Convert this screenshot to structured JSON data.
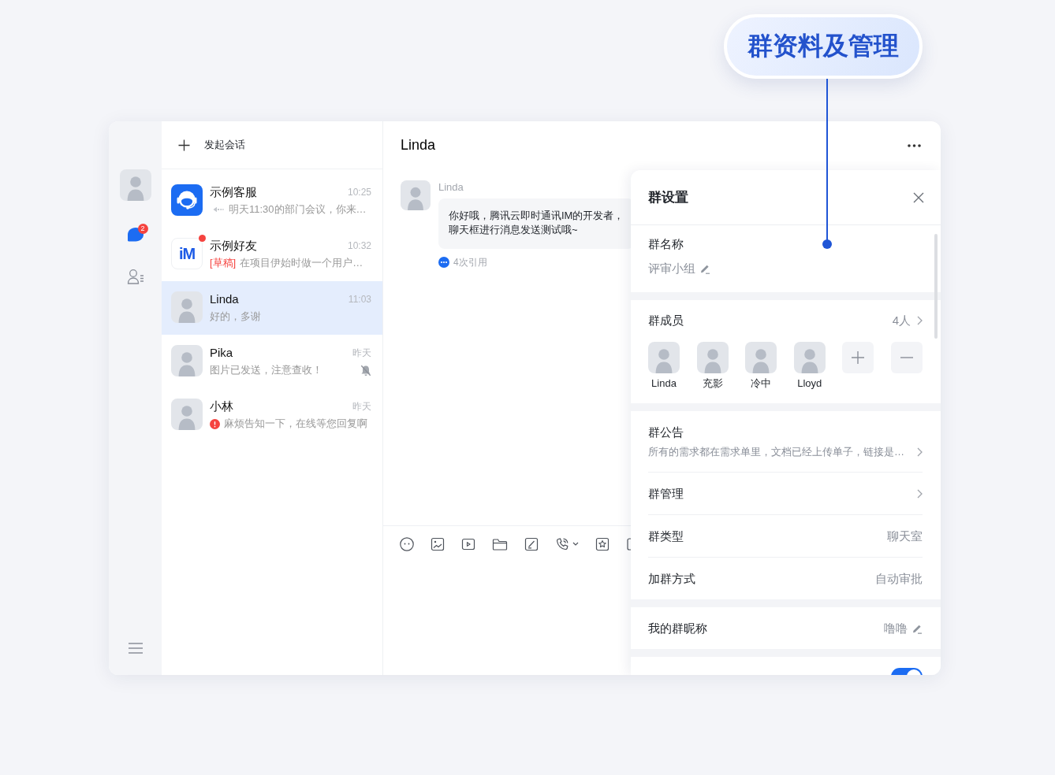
{
  "callout": {
    "title": "群资料及管理"
  },
  "nav": {
    "items": [
      {
        "kind": "chat",
        "selected": true,
        "badge": "2"
      },
      {
        "kind": "contacts",
        "selected": false
      }
    ]
  },
  "conversation_list": {
    "new_chat_label": "发起会话",
    "items": [
      {
        "name": "示例客服",
        "time": "10:25",
        "avatar": {
          "kind": "service"
        },
        "preview": {
          "kind": "reply",
          "text": "明天11:30的部门会议，你来…"
        },
        "unread": false,
        "muted": false,
        "selected": false
      },
      {
        "name": "示例好友",
        "time": "10:32",
        "avatar": {
          "kind": "logo",
          "text": "iM"
        },
        "preview": {
          "kind": "draft",
          "tag": "[草稿]",
          "text": "在项目伊始时做一个用户…"
        },
        "unread": true,
        "muted": false,
        "selected": false
      },
      {
        "name": "Linda",
        "time": "11:03",
        "avatar": {
          "kind": "photo"
        },
        "preview": {
          "kind": "plain",
          "text": "好的，多谢"
        },
        "unread": false,
        "muted": false,
        "selected": true
      },
      {
        "name": "Pika",
        "time": "昨天",
        "avatar": {
          "kind": "photo"
        },
        "preview": {
          "kind": "plain",
          "text": "图片已发送，注意查收！"
        },
        "unread": false,
        "muted": true,
        "selected": false
      },
      {
        "name": "小林",
        "time": "昨天",
        "avatar": {
          "kind": "photo"
        },
        "preview": {
          "kind": "failed",
          "text": "麻烦告知一下，在线等您回复啊"
        },
        "unread": false,
        "muted": false,
        "selected": false
      }
    ]
  },
  "chat": {
    "title": "Linda",
    "messages": [
      {
        "sender": "Linda",
        "text": "你好哦，腾讯云即时通讯IM的开发者，聊天框进行消息发送测试哦~",
        "quote_count": "4次引用"
      }
    ]
  },
  "group_settings": {
    "title": "群设置",
    "sections": [
      {
        "rows": [
          {
            "kind": "editable",
            "label": "群名称",
            "value": "评审小组"
          }
        ]
      },
      {
        "rows": [
          {
            "kind": "members",
            "label": "群成员",
            "count": "4人",
            "members": [
              {
                "name": "Linda"
              },
              {
                "name": "充影"
              },
              {
                "name": "冷中"
              },
              {
                "name": "Lloyd"
              }
            ]
          }
        ]
      },
      {
        "rows": [
          {
            "kind": "notice",
            "label": "群公告",
            "value": "所有的需求都在需求单里，文档已经上传单子，链接是…"
          },
          {
            "kind": "link",
            "label": "群管理"
          },
          {
            "kind": "value",
            "label": "群类型",
            "value": "聊天室"
          },
          {
            "kind": "value",
            "label": "加群方式",
            "value": "自动审批"
          }
        ]
      },
      {
        "rows": [
          {
            "kind": "inline_edit",
            "label": "我的群昵称",
            "value": "噜噜"
          }
        ]
      },
      {
        "rows": [
          {
            "kind": "toggle",
            "on": true
          }
        ]
      }
    ]
  }
}
